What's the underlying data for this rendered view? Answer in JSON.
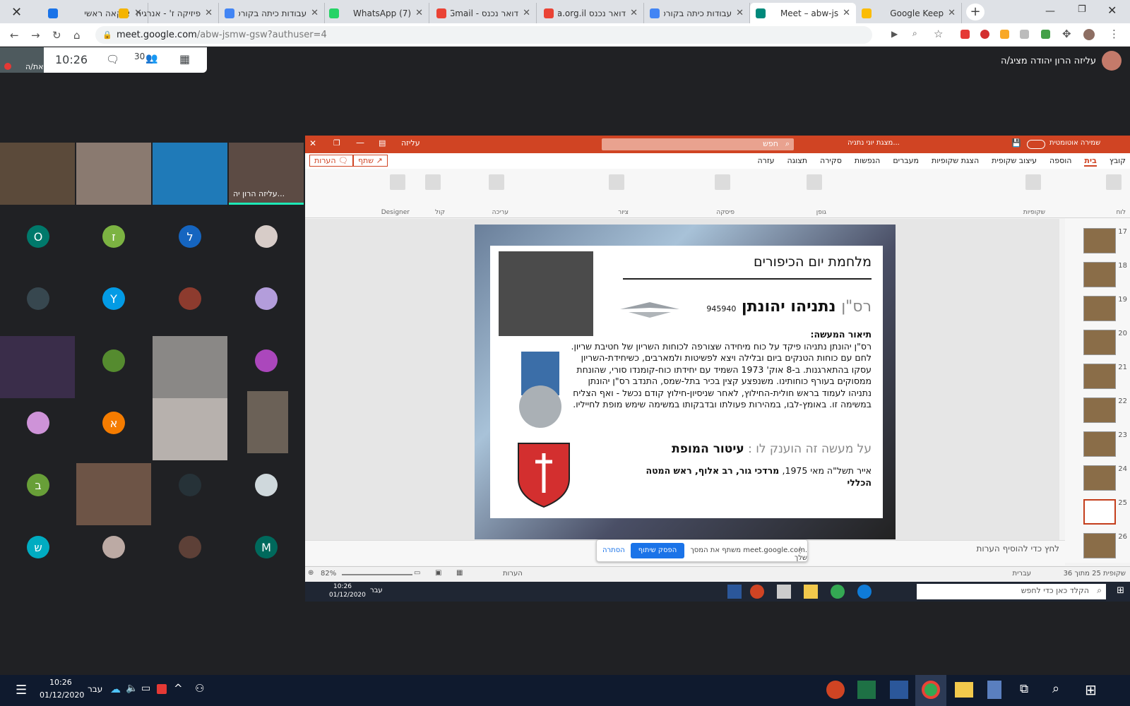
{
  "browser": {
    "tabs": [
      {
        "title": "איקאה ראשי",
        "favicon_color": "#1a73e8",
        "active": false
      },
      {
        "title": "פיזיקה ז' - אנרגיה",
        "favicon_color": "#f4b400",
        "active": false
      },
      {
        "title": "עבודות כיתה בקורס",
        "favicon_color": "#4285f4",
        "active": false
      },
      {
        "title": "(7) WhatsApp",
        "favicon_color": "#25d366",
        "active": false
      },
      {
        "title": "דואר נכנס - Gmail",
        "favicon_color": "#ea4335",
        "active": false
      },
      {
        "title": "דואר נכנס fa.org.il",
        "favicon_color": "#ea4335",
        "active": false
      },
      {
        "title": "עבודות כיתה בקורס",
        "favicon_color": "#4285f4",
        "active": false
      },
      {
        "title": "Meet – abw-js",
        "favicon_color": "#00897b",
        "active": true
      },
      {
        "title": "Google Keep",
        "favicon_color": "#fbbc04",
        "active": false
      }
    ],
    "url_domain": "meet.google.com",
    "url_path": "/abw-jsmw-gsw?authuser=4"
  },
  "meet": {
    "self_label": "את/ה",
    "time": "10:26",
    "participants_count": "30",
    "presenter_text": "עליזה הרון יהודה מציג/ה",
    "first_tile_name": "עליזה הרון יה...",
    "avatars": [
      {
        "letter": "O",
        "color": "#00796b"
      },
      {
        "letter": "ז",
        "color": "#7cb342"
      },
      {
        "letter": "ל",
        "color": "#1565c0"
      },
      {
        "letter": "Y",
        "color": "#039be5"
      },
      {
        "letter": "א",
        "color": "#f57c00"
      },
      {
        "letter": "ב",
        "color": "#689f38"
      },
      {
        "letter": "ש",
        "color": "#00acc1"
      },
      {
        "letter": "M",
        "color": "#00695c"
      }
    ],
    "share_bar": {
      "message": ".meet.google.com משתף את המסך שלך",
      "stop_label": "הפסק שיתוף",
      "hide_label": "הסתרה"
    }
  },
  "powerpoint": {
    "title": "מצגת יוני נתניה...",
    "autosave": "שמירה אוטומטית",
    "search_placeholder": "חפש",
    "user": "עליזה",
    "tabs": [
      "קובץ",
      "בית",
      "הוספה",
      "עיצוב שקופית",
      "הצגת שקופיות",
      "מעברים",
      "הנפשות",
      "סקירה",
      "תצוגה",
      "עזרה"
    ],
    "share_label": "שתף",
    "comments_label": "הערות",
    "ribbon_groups": [
      "לוח",
      "שקופיות",
      "גופן",
      "פיסקה",
      "ציור",
      "עריכה",
      "קול",
      "Designer"
    ],
    "notes_prompt": "לחץ כדי להוסיף הערות",
    "status_slide": "שקופית 25 מתוך 36",
    "status_lang": "עברית",
    "notes_btn": "הערות",
    "zoom": "82%",
    "thumb_numbers": [
      "17",
      "18",
      "19",
      "20",
      "21",
      "22",
      "23",
      "24",
      "25",
      "26"
    ]
  },
  "slide": {
    "title": "מלחמת יום הכיפורים",
    "rank": "רס\"ן",
    "name": "נתניהו יהונתן",
    "id_number": "945940",
    "desc_heading": "תיאור המעשה:",
    "desc_body": "רס\"ן יהונתן נתניהו פיקד על כוח מיחידה שצורפה לכוחות השריון של חטיבת שריון. לחם עם כוחות הטנקים ביום ובלילה ויצא לפשיטות ולמארבים, כשיחידת-השריון עסקו בהתארגנות. ב-8 אוק' 1973 השמיד עם יחידתו כוח-קומנדו סורי, שהונחת ממסוקים בעורף כוחותינו. משנפצע קצין בכיר בתל-שמס, התנדב רס\"ן יהונתן נתניהו לעמוד בראש חולית-החילוץ, לאחר שניסיון-חילוץ קודם נכשל - ואף הצליח במשימה זו. באומץ-לבו, במהירות פעולתו ובדבקותו במשימה שימש מופת לחייליו.",
    "award_prefix": "על מעשה זה הוענק לו :",
    "award_name": "עיטור המופת",
    "sign_date": "אייר תשל\"ה מאי 1975,",
    "sign_name": "מרדכי גור, רב אלוף, ראש המטה הכללי"
  },
  "inner_taskbar": {
    "search_placeholder": "הקלד כאן כדי לחפש",
    "time": "10:26",
    "date": "01/12/2020",
    "lang": "עבר"
  },
  "system_taskbar": {
    "time": "10:26",
    "date": "01/12/2020",
    "lang": "עבר"
  }
}
